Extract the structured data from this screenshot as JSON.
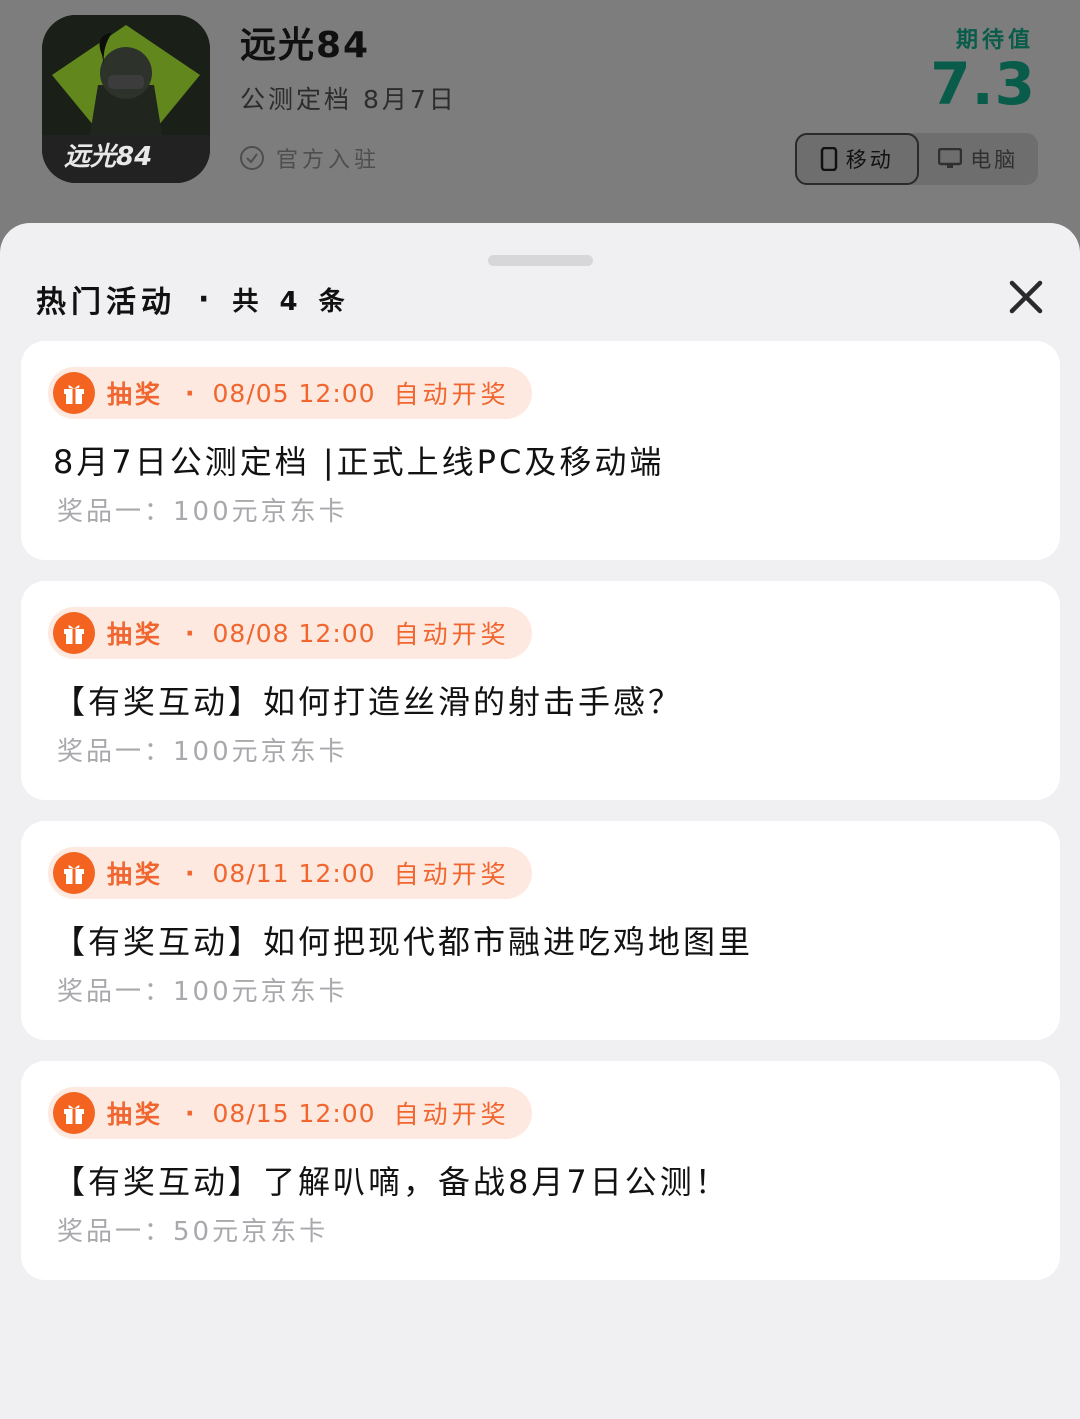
{
  "app": {
    "name": "远光84",
    "subtitle": "公测定档 8月7日",
    "official": "官方入驻",
    "expect_label": "期待值",
    "expect_value": "7.3",
    "platforms": [
      {
        "label": "移动",
        "icon": "phone-icon",
        "active": true
      },
      {
        "label": "电脑",
        "icon": "monitor-icon",
        "active": false
      }
    ]
  },
  "sheet": {
    "title": "热门活动",
    "dot": "·",
    "count": "共 4 条"
  },
  "activities": [
    {
      "type": "抽奖",
      "time": "08/05 12:00",
      "auto": "自动开奖",
      "title": "8月7日公测定档 |正式上线PC及移动端",
      "prize": "奖品一：100元京东卡"
    },
    {
      "type": "抽奖",
      "time": "08/08 12:00",
      "auto": "自动开奖",
      "title": "【有奖互动】如何打造丝滑的射击手感？",
      "prize": "奖品一：100元京东卡"
    },
    {
      "type": "抽奖",
      "time": "08/11 12:00",
      "auto": "自动开奖",
      "title": "【有奖互动】如何把现代都市融进吃鸡地图里",
      "prize": "奖品一：100元京东卡"
    },
    {
      "type": "抽奖",
      "time": "08/15 12:00",
      "auto": "自动开奖",
      "title": "【有奖互动】了解叭嘀，备战8月7日公测！",
      "prize": "奖品一：50元京东卡"
    }
  ],
  "colors": {
    "accent_orange": "#f4631f",
    "badge_bg": "#fde9e0",
    "expect_green": "#0a5c4a"
  }
}
